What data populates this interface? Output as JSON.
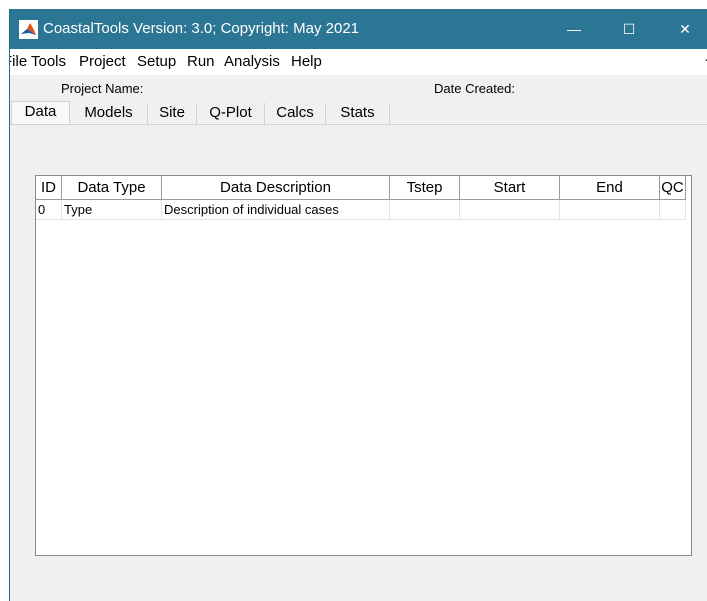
{
  "window": {
    "title": "CoastalTools  Version: 3.0;  Copyright: May 2021",
    "minimize_symbol": "—",
    "maximize_symbol": "☐",
    "close_symbol": "✕",
    "icon": "matlab-logo-icon",
    "titlebar_color": "#2b7595"
  },
  "menu": {
    "items": [
      "File",
      "Tools",
      "Project",
      "Setup",
      "Run",
      "Analysis",
      "Help"
    ],
    "overflow_arrow": "➔"
  },
  "project_info": {
    "project_name_label": "Project Name:",
    "date_created_label": "Date Created:"
  },
  "tabs": [
    "Data",
    "Models",
    "Site",
    "Q-Plot",
    "Calcs",
    "Stats"
  ],
  "active_tab": "Data",
  "table": {
    "columns": [
      "ID",
      "Data Type",
      "Data Description",
      "Tstep",
      "Start",
      "End",
      "QC"
    ],
    "rows": [
      [
        "0",
        "Type",
        "Description of individual cases",
        "",
        "",
        "",
        ""
      ]
    ]
  }
}
